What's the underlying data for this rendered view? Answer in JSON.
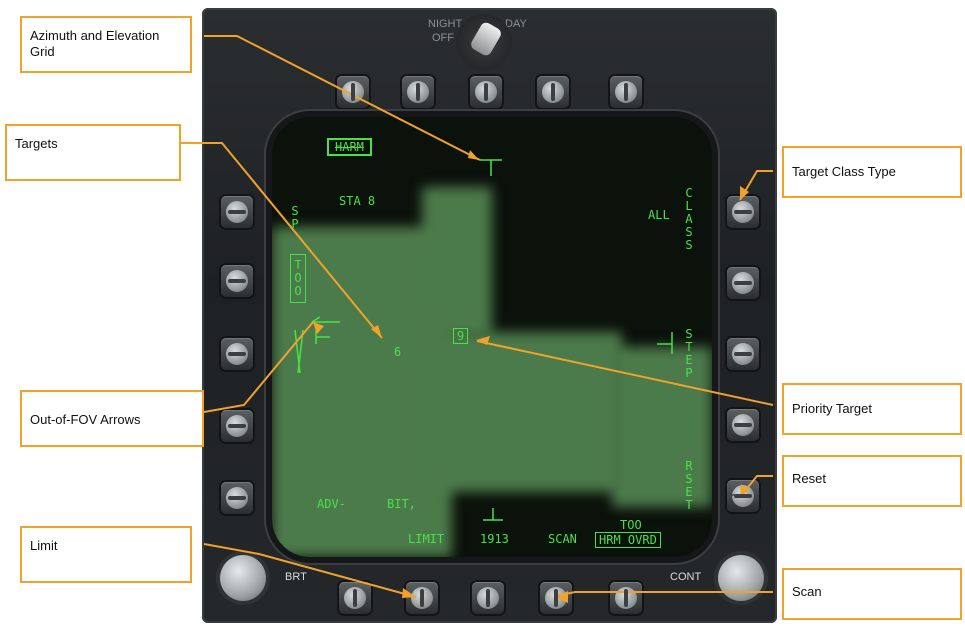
{
  "switch": {
    "night": "NIGHT",
    "off": "OFF",
    "day": "DAY"
  },
  "knobs": {
    "brt": "BRT",
    "cont": "CONT"
  },
  "display": {
    "harm": "HARM",
    "sta": "STA 8",
    "left_vertical_1": "SP",
    "left_vertical_2": "TOO",
    "class_all": "ALL",
    "class_vertical": "CLASS",
    "step_vertical": "STEP",
    "rset_vertical": "RSET",
    "target_6": "6",
    "priority_target": "9",
    "adv": "ADV-",
    "bit": "BIT,",
    "limit": "LIMIT",
    "range": "1913",
    "scan": "SCAN",
    "too_bottom": "TOO",
    "hrm_ovrd": "HRM OVRD"
  },
  "callouts": {
    "azimuth": "Azimuth and Elevation Grid",
    "targets": "Targets",
    "out_of_fov": "Out-of-FOV Arrows",
    "limit": "Limit",
    "target_class": "Target Class Type",
    "priority": "Priority Target",
    "reset": "Reset",
    "scan": "Scan"
  },
  "colors": {
    "accent": "#f0a22a",
    "symbology": "#49e14a"
  }
}
